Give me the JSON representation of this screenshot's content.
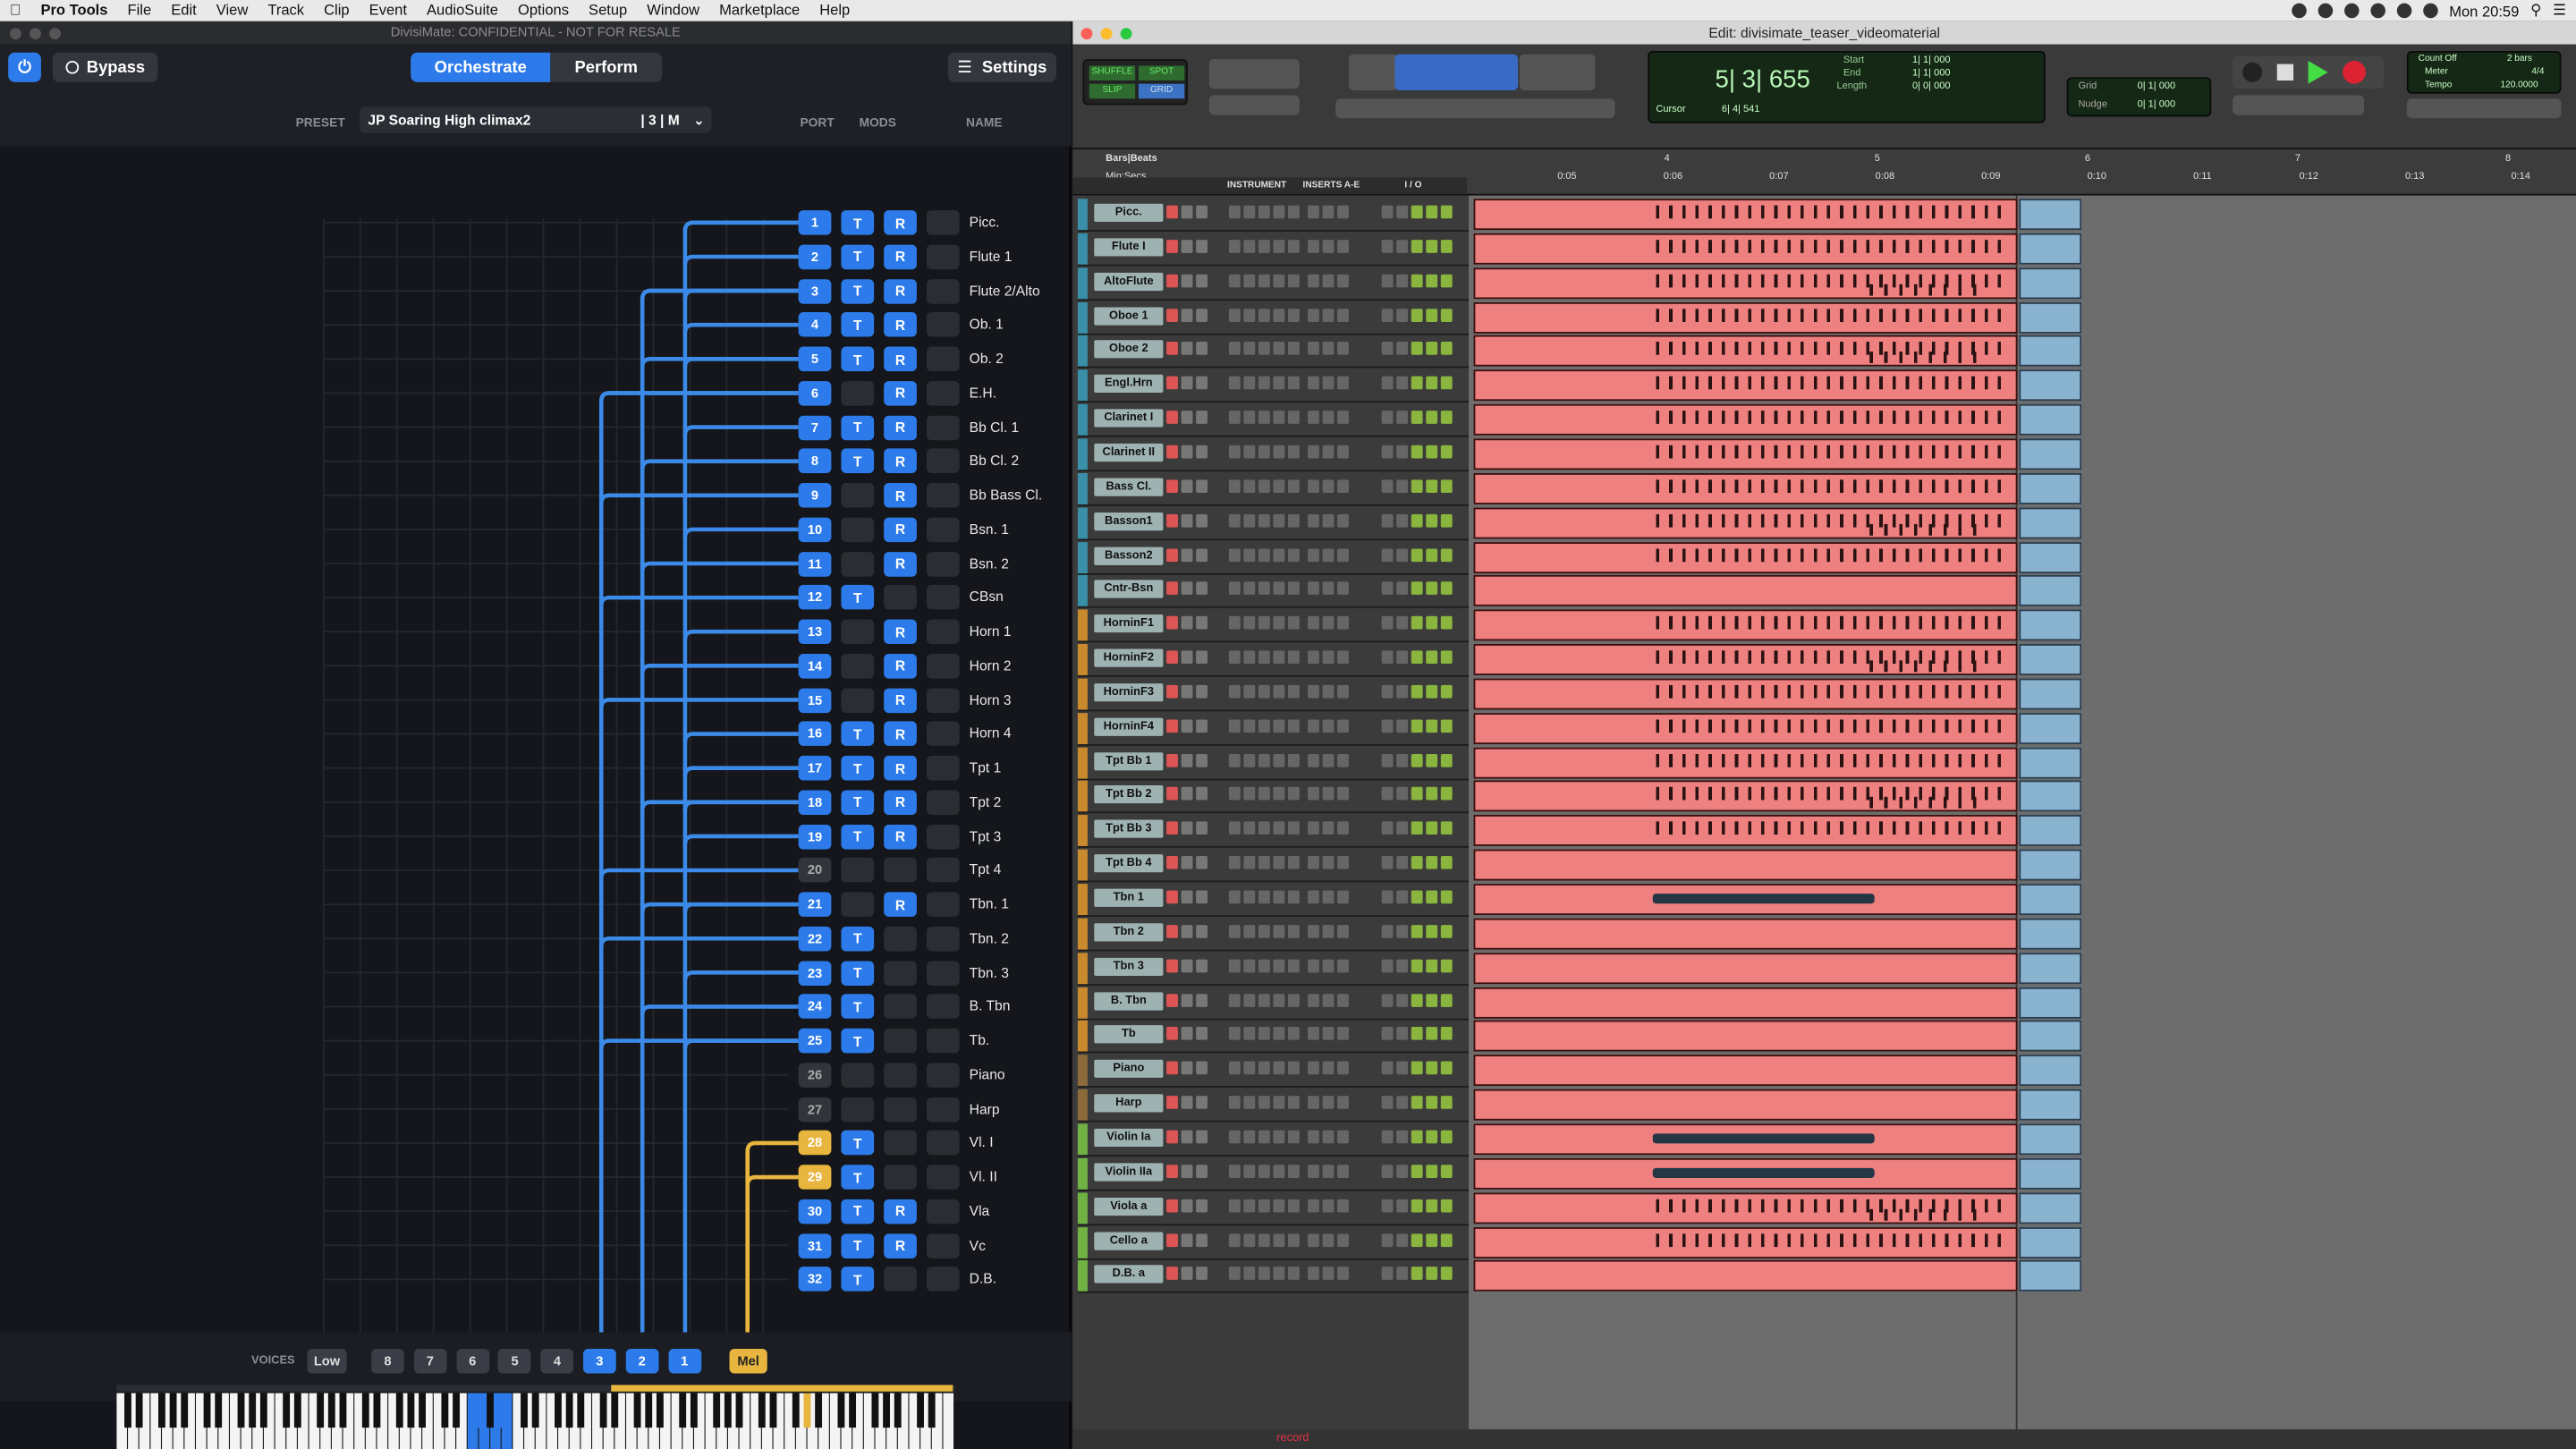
{
  "menubar": {
    "apple": "",
    "items": [
      "Pro Tools",
      "File",
      "Edit",
      "View",
      "Track",
      "Clip",
      "Event",
      "AudioSuite",
      "Options",
      "Setup",
      "Window",
      "Marketplace",
      "Help"
    ],
    "clock": "Mon 20:59"
  },
  "plugin": {
    "window_title": "DivisiMate: CONFIDENTIAL - NOT FOR RESALE",
    "bypass_label": "Bypass",
    "tab_orchestrate": "Orchestrate",
    "tab_perform": "Perform",
    "settings_label": "Settings",
    "preset_label": "PRESET",
    "preset_value": "JP Soaring High climax2",
    "preset_suffix": "| 3 | M",
    "col_port": "PORT",
    "col_mods": "MODS",
    "col_name": "NAME",
    "voices_label": "VOICES",
    "voice_low": "Low",
    "voice_buttons": [
      "8",
      "7",
      "6",
      "5",
      "4",
      "3",
      "2",
      "1"
    ],
    "voice_active": [
      "3",
      "2",
      "1"
    ],
    "voice_mel": "Mel",
    "accent": "#2d7bea",
    "mel_color": "#e8b53e",
    "rows": [
      {
        "n": "1",
        "t": true,
        "r": true,
        "name": "Picc."
      },
      {
        "n": "2",
        "t": true,
        "r": true,
        "name": "Flute 1"
      },
      {
        "n": "3",
        "t": true,
        "r": true,
        "name": "Flute 2/Alto"
      },
      {
        "n": "4",
        "t": true,
        "r": true,
        "name": "Ob. 1"
      },
      {
        "n": "5",
        "t": true,
        "r": true,
        "name": "Ob. 2"
      },
      {
        "n": "6",
        "t": false,
        "r": true,
        "name": "E.H."
      },
      {
        "n": "7",
        "t": true,
        "r": true,
        "name": "Bb Cl. 1"
      },
      {
        "n": "8",
        "t": true,
        "r": true,
        "name": "Bb Cl. 2"
      },
      {
        "n": "9",
        "t": false,
        "r": true,
        "name": "Bb Bass Cl."
      },
      {
        "n": "10",
        "t": false,
        "r": true,
        "name": "Bsn. 1"
      },
      {
        "n": "11",
        "t": false,
        "r": true,
        "name": "Bsn. 2"
      },
      {
        "n": "12",
        "t": true,
        "r": false,
        "name": "CBsn"
      },
      {
        "n": "13",
        "t": false,
        "r": true,
        "name": "Horn 1"
      },
      {
        "n": "14",
        "t": false,
        "r": true,
        "name": "Horn 2"
      },
      {
        "n": "15",
        "t": false,
        "r": true,
        "name": "Horn 3"
      },
      {
        "n": "16",
        "t": true,
        "r": true,
        "name": "Horn 4"
      },
      {
        "n": "17",
        "t": true,
        "r": true,
        "name": "Tpt 1"
      },
      {
        "n": "18",
        "t": true,
        "r": true,
        "name": "Tpt 2"
      },
      {
        "n": "19",
        "t": true,
        "r": true,
        "name": "Tpt 3"
      },
      {
        "n": "20",
        "t": false,
        "r": false,
        "name": "Tpt 4",
        "off": true
      },
      {
        "n": "21",
        "t": false,
        "r": true,
        "name": "Tbn. 1"
      },
      {
        "n": "22",
        "t": true,
        "r": false,
        "name": "Tbn. 2"
      },
      {
        "n": "23",
        "t": true,
        "r": false,
        "name": "Tbn. 3"
      },
      {
        "n": "24",
        "t": true,
        "r": false,
        "name": "B. Tbn"
      },
      {
        "n": "25",
        "t": true,
        "r": false,
        "name": "Tb."
      },
      {
        "n": "26",
        "t": false,
        "r": false,
        "name": "Piano",
        "off": true
      },
      {
        "n": "27",
        "t": false,
        "r": false,
        "name": "Harp",
        "off": true
      },
      {
        "n": "28",
        "t": true,
        "r": false,
        "name": "Vl. I",
        "mel": true
      },
      {
        "n": "29",
        "t": true,
        "r": false,
        "name": "Vl. II",
        "mel": true
      },
      {
        "n": "30",
        "t": true,
        "r": true,
        "name": "Vla"
      },
      {
        "n": "31",
        "t": true,
        "r": true,
        "name": "Vc"
      },
      {
        "n": "32",
        "t": true,
        "r": false,
        "name": "D.B."
      }
    ],
    "t_label": "T",
    "r_label": "R"
  },
  "protools": {
    "window_title": "Edit: divisimate_teaser_videomaterial",
    "mode_shuffle": "SHUFFLE",
    "mode_spot": "SPOT",
    "mode_slip": "SLIP",
    "mode_grid": "GRID",
    "counter_main": "5| 3| 655",
    "counter_start_label": "Start",
    "counter_end_label": "End",
    "counter_length_label": "Length",
    "counter_start": "1| 1| 000",
    "counter_end": "1| 1| 000",
    "counter_length": "0| 0| 000",
    "cursor_label": "Cursor",
    "cursor_value": "6| 4| 541",
    "grid_label": "Grid",
    "grid_value": "0| 1| 000",
    "nudge_label": "Nudge",
    "nudge_value": "0| 1| 000",
    "count_off": "Count Off",
    "meter_label": "Meter",
    "tempo_label": "Tempo",
    "bars_value": "2 bars",
    "meter_value": "4/4",
    "tempo_value": "120.0000",
    "ruler_bars_label": "Bars|Beats",
    "ruler_min_label": "Min:Secs",
    "ruler_bars": [
      "4",
      "5",
      "6",
      "7",
      "8"
    ],
    "ruler_secs": [
      "0:05",
      "0:06",
      "0:07",
      "0:08",
      "0:09",
      "0:10",
      "0:11",
      "0:12",
      "0:13",
      "0:14"
    ],
    "hdr_instrument": "INSTRUMENT",
    "hdr_inserts": "INSERTS A-E",
    "hdr_io": "I / O",
    "bottom_text": "record",
    "tracks": [
      {
        "name": "Picc.",
        "c": "#3a8fa8",
        "p": "dots"
      },
      {
        "name": "Flute I",
        "c": "#3a8fa8",
        "p": "dots"
      },
      {
        "name": "AltoFlute",
        "c": "#3a8fa8",
        "p": "dots2"
      },
      {
        "name": "Oboe 1",
        "c": "#3a8fa8",
        "p": "dots"
      },
      {
        "name": "Oboe 2",
        "c": "#3a8fa8",
        "p": "dots2"
      },
      {
        "name": "Engl.Hrn",
        "c": "#3a8fa8",
        "p": "dots"
      },
      {
        "name": "Clarinet I",
        "c": "#3a8fa8",
        "p": "dots"
      },
      {
        "name": "Clarinet II",
        "c": "#3a8fa8",
        "p": "dots"
      },
      {
        "name": "Bass Cl.",
        "c": "#3a8fa8",
        "p": "dots"
      },
      {
        "name": "Basson1",
        "c": "#3a8fa8",
        "p": "dots2"
      },
      {
        "name": "Basson2",
        "c": "#3a8fa8",
        "p": "dots"
      },
      {
        "name": "Cntr-Bsn",
        "c": "#3a8fa8",
        "p": "none"
      },
      {
        "name": "HorninF1",
        "c": "#c98a2e",
        "p": "dots"
      },
      {
        "name": "HorninF2",
        "c": "#c98a2e",
        "p": "dots2"
      },
      {
        "name": "HorninF3",
        "c": "#c98a2e",
        "p": "dots"
      },
      {
        "name": "HorninF4",
        "c": "#c98a2e",
        "p": "dots"
      },
      {
        "name": "Tpt Bb 1",
        "c": "#c98a2e",
        "p": "dots"
      },
      {
        "name": "Tpt Bb 2",
        "c": "#c98a2e",
        "p": "dots2"
      },
      {
        "name": "Tpt Bb 3",
        "c": "#c98a2e",
        "p": "dots"
      },
      {
        "name": "Tpt Bb 4",
        "c": "#c98a2e",
        "p": "none"
      },
      {
        "name": "Tbn 1",
        "c": "#c98a2e",
        "p": "bar"
      },
      {
        "name": "Tbn 2",
        "c": "#c98a2e",
        "p": "none"
      },
      {
        "name": "Tbn 3",
        "c": "#c98a2e",
        "p": "none"
      },
      {
        "name": "B. Tbn",
        "c": "#c98a2e",
        "p": "none"
      },
      {
        "name": "Tb",
        "c": "#c98a2e",
        "p": "none"
      },
      {
        "name": "Piano",
        "c": "#8c6a3c",
        "p": "none"
      },
      {
        "name": "Harp",
        "c": "#8c6a3c",
        "p": "none"
      },
      {
        "name": "Violin Ia",
        "c": "#6fb143",
        "p": "bar"
      },
      {
        "name": "Violin IIa",
        "c": "#6fb143",
        "p": "bar"
      },
      {
        "name": "Viola a",
        "c": "#6fb143",
        "p": "dots2"
      },
      {
        "name": "Cello a",
        "c": "#6fb143",
        "p": "dots"
      },
      {
        "name": "D.B. a",
        "c": "#6fb143",
        "p": "none"
      }
    ]
  }
}
